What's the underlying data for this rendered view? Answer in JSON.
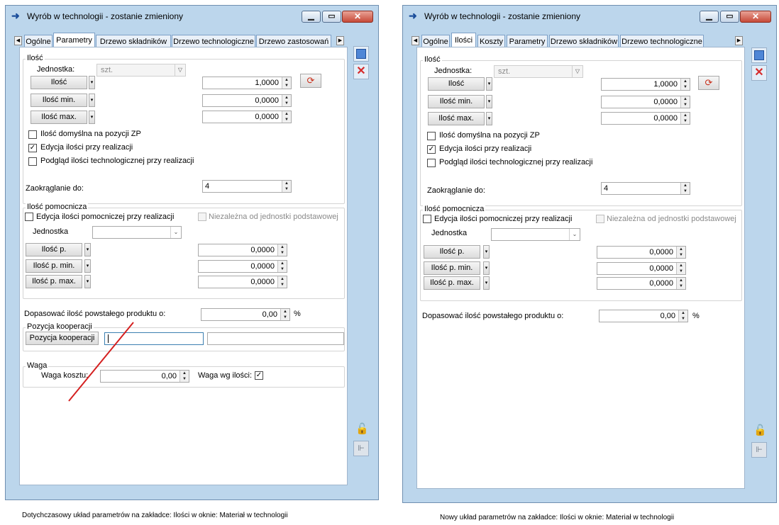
{
  "left": {
    "title": "Wyrób w technologii - zostanie zmieniony",
    "tabs": [
      "Ogólne",
      "Parametry",
      "Drzewo składników",
      "Drzewo technologiczne",
      "Drzewo zastosowań"
    ],
    "ilosc": {
      "group_label": "Ilość",
      "jednostka_label": "Jednostka:",
      "jednostka_value": "szt.",
      "ilosc_btn": "Ilość",
      "ilosc_value": "1,0000",
      "ilosc_min_btn": "Ilość min.",
      "ilosc_min_value": "0,0000",
      "ilosc_max_btn": "Ilość max.",
      "ilosc_max_value": "0,0000",
      "chk_domyslna": "Ilość domyślna na pozycji ZP",
      "chk_edycja": "Edycja ilości przy realizacji",
      "chk_podglad": "Podgląd ilości technologicznej przy realizacji",
      "zaokr_label": "Zaokrąglanie do:",
      "zaokr_value": "4"
    },
    "pomocnicza": {
      "group_label": "Ilość pomocnicza",
      "chk_edycja": "Edycja ilości pomocniczej przy realizacji",
      "chk_niezalezna": "Niezależna od jednostki podstawowej",
      "jednostka_label": "Jednostka",
      "ilosc_p_btn": "Ilość p.",
      "ilosc_p_value": "0,0000",
      "ilosc_p_min_btn": "Ilość p. min.",
      "ilosc_p_min_value": "0,0000",
      "ilosc_p_max_btn": "Ilość p. max.",
      "ilosc_p_max_value": "0,0000"
    },
    "dopasowac_label": "Dopasować ilość powstałego produktu o:",
    "dopasowac_value": "0,00",
    "percent": "%",
    "kooperacja": {
      "group_label": "Pozycja kooperacji",
      "btn": "Pozycja kooperacji"
    },
    "waga": {
      "group_label": "Waga",
      "koszt_label": "Waga kosztu:",
      "koszt_value": "0,00",
      "wg_ilosci_label": "Waga wg ilości:"
    },
    "caption": "Dotychczasowy układ parametrów na zakładce: Ilości w oknie: Materiał w technologii"
  },
  "right": {
    "title": "Wyrób w technologii - zostanie zmieniony",
    "tabs": [
      "Ogólne",
      "Ilości",
      "Koszty",
      "Parametry",
      "Drzewo składników",
      "Drzewo technologiczne"
    ],
    "ilosc": {
      "group_label": "Ilość",
      "jednostka_label": "Jednostka:",
      "jednostka_value": "szt.",
      "ilosc_btn": "Ilość",
      "ilosc_value": "1,0000",
      "ilosc_min_btn": "Ilość min.",
      "ilosc_min_value": "0,0000",
      "ilosc_max_btn": "Ilość max.",
      "ilosc_max_value": "0,0000",
      "chk_domyslna": "Ilość domyślna na pozycji ZP",
      "chk_edycja": "Edycja ilości przy realizacji",
      "chk_podglad": "Podgląd ilości technologicznej przy realizacji",
      "zaokr_label": "Zaokrąglanie do:",
      "zaokr_value": "4"
    },
    "pomocnicza": {
      "group_label": "Ilość pomocnicza",
      "chk_edycja": "Edycja ilości pomocniczej przy realizacji",
      "chk_niezalezna": "Niezależna od jednostki podstawowej",
      "jednostka_label": "Jednostka",
      "ilosc_p_btn": "Ilość p.",
      "ilosc_p_value": "0,0000",
      "ilosc_p_min_btn": "Ilość p. min.",
      "ilosc_p_min_value": "0,0000",
      "ilosc_p_max_btn": "Ilość p. max.",
      "ilosc_p_max_value": "0,0000"
    },
    "dopasowac_label": "Dopasować ilość powstałego produktu o:",
    "dopasowac_value": "0,00",
    "percent": "%",
    "caption": "Nowy układ parametrów na zakładce: Ilości w oknie: Materiał w technologii"
  },
  "icons": {
    "save": "save-icon",
    "delete": "delete-x-icon",
    "lock": "padlock-icon",
    "pin": "pin-icon",
    "recalc": "recalculate-icon"
  }
}
